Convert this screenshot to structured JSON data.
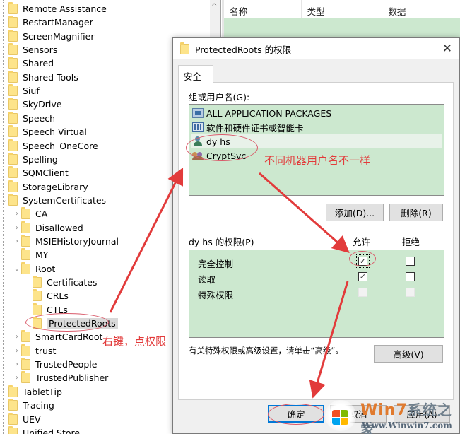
{
  "tree": {
    "items": [
      {
        "label": "Remote Assistance",
        "level": 0,
        "expander": ""
      },
      {
        "label": "RestartManager",
        "level": 0,
        "expander": ""
      },
      {
        "label": "ScreenMagnifier",
        "level": 0,
        "expander": ""
      },
      {
        "label": "Sensors",
        "level": 0,
        "expander": ""
      },
      {
        "label": "Shared",
        "level": 0,
        "expander": ""
      },
      {
        "label": "Shared Tools",
        "level": 0,
        "expander": ""
      },
      {
        "label": "Siuf",
        "level": 0,
        "expander": ""
      },
      {
        "label": "SkyDrive",
        "level": 0,
        "expander": ""
      },
      {
        "label": "Speech",
        "level": 0,
        "expander": ""
      },
      {
        "label": "Speech Virtual",
        "level": 0,
        "expander": ""
      },
      {
        "label": "Speech_OneCore",
        "level": 0,
        "expander": ""
      },
      {
        "label": "Spelling",
        "level": 0,
        "expander": ""
      },
      {
        "label": "SQMClient",
        "level": 0,
        "expander": ""
      },
      {
        "label": "StorageLibrary",
        "level": 0,
        "expander": ""
      },
      {
        "label": "SystemCertificates",
        "level": 0,
        "expander": "⌄"
      },
      {
        "label": "CA",
        "level": 1,
        "expander": "›"
      },
      {
        "label": "Disallowed",
        "level": 1,
        "expander": "›"
      },
      {
        "label": "MSIEHistoryJournal",
        "level": 1,
        "expander": "›"
      },
      {
        "label": "MY",
        "level": 1,
        "expander": ""
      },
      {
        "label": "Root",
        "level": 1,
        "expander": "⌄"
      },
      {
        "label": "Certificates",
        "level": 2,
        "expander": ""
      },
      {
        "label": "CRLs",
        "level": 2,
        "expander": ""
      },
      {
        "label": "CTLs",
        "level": 2,
        "expander": ""
      },
      {
        "label": "ProtectedRoots",
        "level": 2,
        "expander": "",
        "selected": true
      },
      {
        "label": "SmartCardRoot",
        "level": 1,
        "expander": "›"
      },
      {
        "label": "trust",
        "level": 1,
        "expander": "›"
      },
      {
        "label": "TrustedPeople",
        "level": 1,
        "expander": "›"
      },
      {
        "label": "TrustedPublisher",
        "level": 1,
        "expander": "›"
      },
      {
        "label": "TabletTip",
        "level": 0,
        "expander": ""
      },
      {
        "label": "Tracing",
        "level": 0,
        "expander": ""
      },
      {
        "label": "UEV",
        "level": 0,
        "expander": ""
      },
      {
        "label": "Unified Store",
        "level": 0,
        "expander": ""
      }
    ],
    "scroll_up_glyph": "^"
  },
  "values_pane": {
    "columns": [
      "名称",
      "类型",
      "数据"
    ]
  },
  "dialog": {
    "title": "ProtectedRoots 的权限",
    "close_glyph": "✕",
    "tab": "安全",
    "groups_label": "组或用户名(G):",
    "principals": [
      {
        "name": "ALL APPLICATION PACKAGES",
        "icon": "package-icon"
      },
      {
        "name": "软件和硬件证书或智能卡",
        "icon": "group-icon"
      },
      {
        "name": "dy hs",
        "icon": "user-icon",
        "selected": true
      },
      {
        "name": "CryptSvc",
        "icon": "users-icon"
      }
    ],
    "add_button": "添加(D)...",
    "remove_button": "删除(R)",
    "perm_label": "dy hs 的权限(P)",
    "allow_header": "允许",
    "deny_header": "拒绝",
    "permissions": [
      {
        "name": "完全控制",
        "allow": true,
        "deny": false,
        "enabled": true
      },
      {
        "name": "读取",
        "allow": true,
        "deny": false,
        "enabled": true
      },
      {
        "name": "特殊权限",
        "allow": false,
        "deny": false,
        "enabled": false
      }
    ],
    "advanced_hint": "有关特殊权限或高级设置，请单击“高级”。",
    "advanced_button": "高级(V)",
    "ok_button": "确定",
    "cancel_button": "取消",
    "apply_button": "应用(A)"
  },
  "annotations": {
    "right_click_hint": "右键，点权限",
    "username_hint": "不同机器用户名不一样",
    "color": "#e23b3b"
  },
  "watermark": {
    "brand": "Win7",
    "brand_cn": "系统之家",
    "url": "Www.Winwin7.com"
  },
  "check_glyph": "✓"
}
